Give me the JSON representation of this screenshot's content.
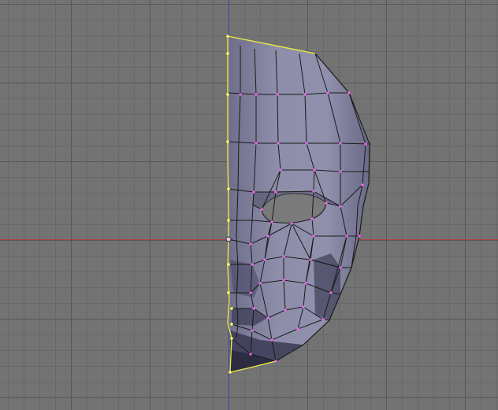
{
  "viewport": {
    "mode": "edit-mesh",
    "background_color": "#737373",
    "grid_color": "#5f5f5f",
    "axis_x_color": "#b04040",
    "axis_z_color": "#4040a8"
  },
  "mesh": {
    "object": "half-face-mask",
    "face_color": "#8a8aa6",
    "shadow_color": "#3c3c52",
    "edge_color": "#1a1a1a",
    "vertex_color": "#ff66ff",
    "selected_edge_color": "#f0f040",
    "selected_vertex_color": "#ffff66"
  },
  "pivot": {
    "icon": "object-origin-circle"
  }
}
